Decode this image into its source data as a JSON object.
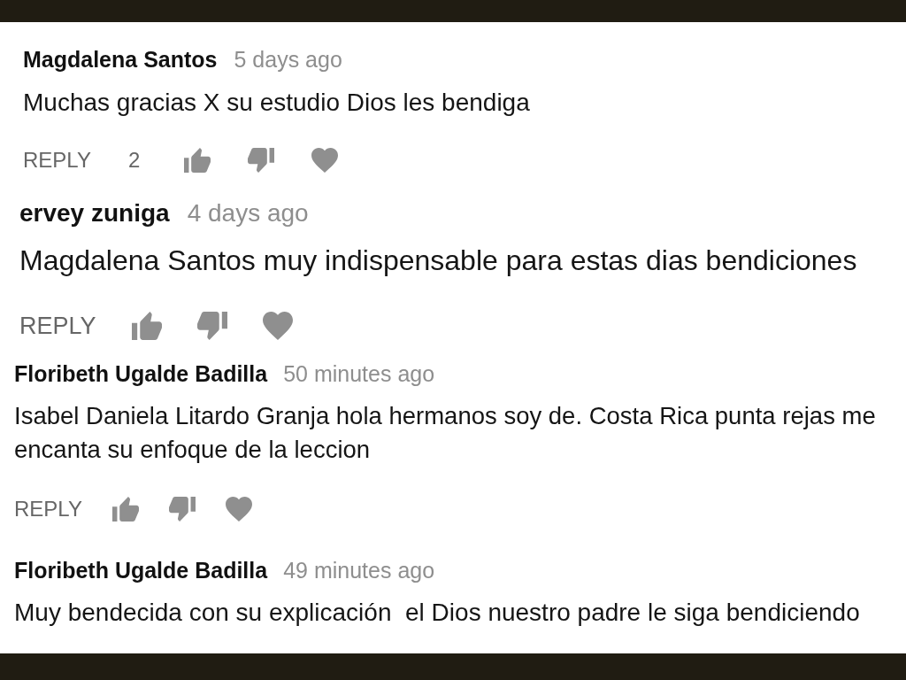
{
  "comments": [
    {
      "author": "Magdalena Santos",
      "time": "5 days ago",
      "text": "Muchas gracias X su estudio Dios les bendiga",
      "actions": {
        "reply": "REPLY",
        "like_count": "2"
      }
    },
    {
      "author": "ervey zuniga",
      "time": "4 days ago",
      "text": "Magdalena Santos muy indispensable para estas dias bendiciones",
      "actions": {
        "reply": "REPLY"
      }
    },
    {
      "author": "Floribeth Ugalde Badilla",
      "time": "50 minutes ago",
      "text": "Isabel Daniela Litardo Granja hola hermanos soy de. Costa Rica punta rejas me encanta su enfoque de la leccion",
      "actions": {
        "reply": "REPLY"
      }
    },
    {
      "author": "Floribeth Ugalde Badilla",
      "time": "49 minutes ago",
      "text": "Muy bendecida con su explicación  el Dios nuestro padre le siga bendiciendo"
    }
  ]
}
